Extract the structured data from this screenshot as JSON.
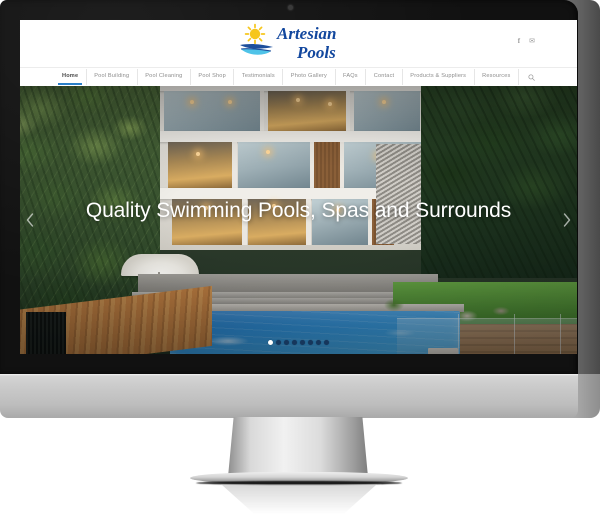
{
  "device": {
    "type": "desktop-monitor",
    "style": "imac-silver"
  },
  "site": {
    "logo": {
      "line1": "Artesian",
      "line2": "Pools",
      "sun_icon": "sun-icon",
      "wave_icon": "wave-icon",
      "text_color": "#12479e",
      "sun_color": "#f6c61d",
      "wave_color": "#1e4f9c",
      "wave_fill_color": "#4fc3e8"
    },
    "social": [
      {
        "name": "facebook-icon",
        "glyph": "f"
      },
      {
        "name": "email-icon",
        "glyph": "✉"
      }
    ],
    "nav": {
      "items": [
        {
          "label": "Home",
          "active": true
        },
        {
          "label": "Pool Building",
          "active": false
        },
        {
          "label": "Pool Cleaning",
          "active": false
        },
        {
          "label": "Pool Shop",
          "active": false
        },
        {
          "label": "Testimonials",
          "active": false
        },
        {
          "label": "Photo Gallery",
          "active": false
        },
        {
          "label": "FAQs",
          "active": false
        },
        {
          "label": "Contact",
          "active": false
        },
        {
          "label": "Products & Suppliers",
          "active": false
        },
        {
          "label": "Resources",
          "active": false
        }
      ],
      "search_icon": "search-icon",
      "active_underline_color": "#2a7fc9"
    },
    "hero": {
      "headline": "Quality Swimming Pools, Spas and Surrounds",
      "prev_arrow_icon": "chevron-left-icon",
      "next_arrow_icon": "chevron-right-icon",
      "slides_total": 8,
      "active_slide": 1,
      "scene_alt": "Modern multi-storey house at dusk with timber deck, blue swimming pool, tropical garden and glass pool fence"
    }
  }
}
